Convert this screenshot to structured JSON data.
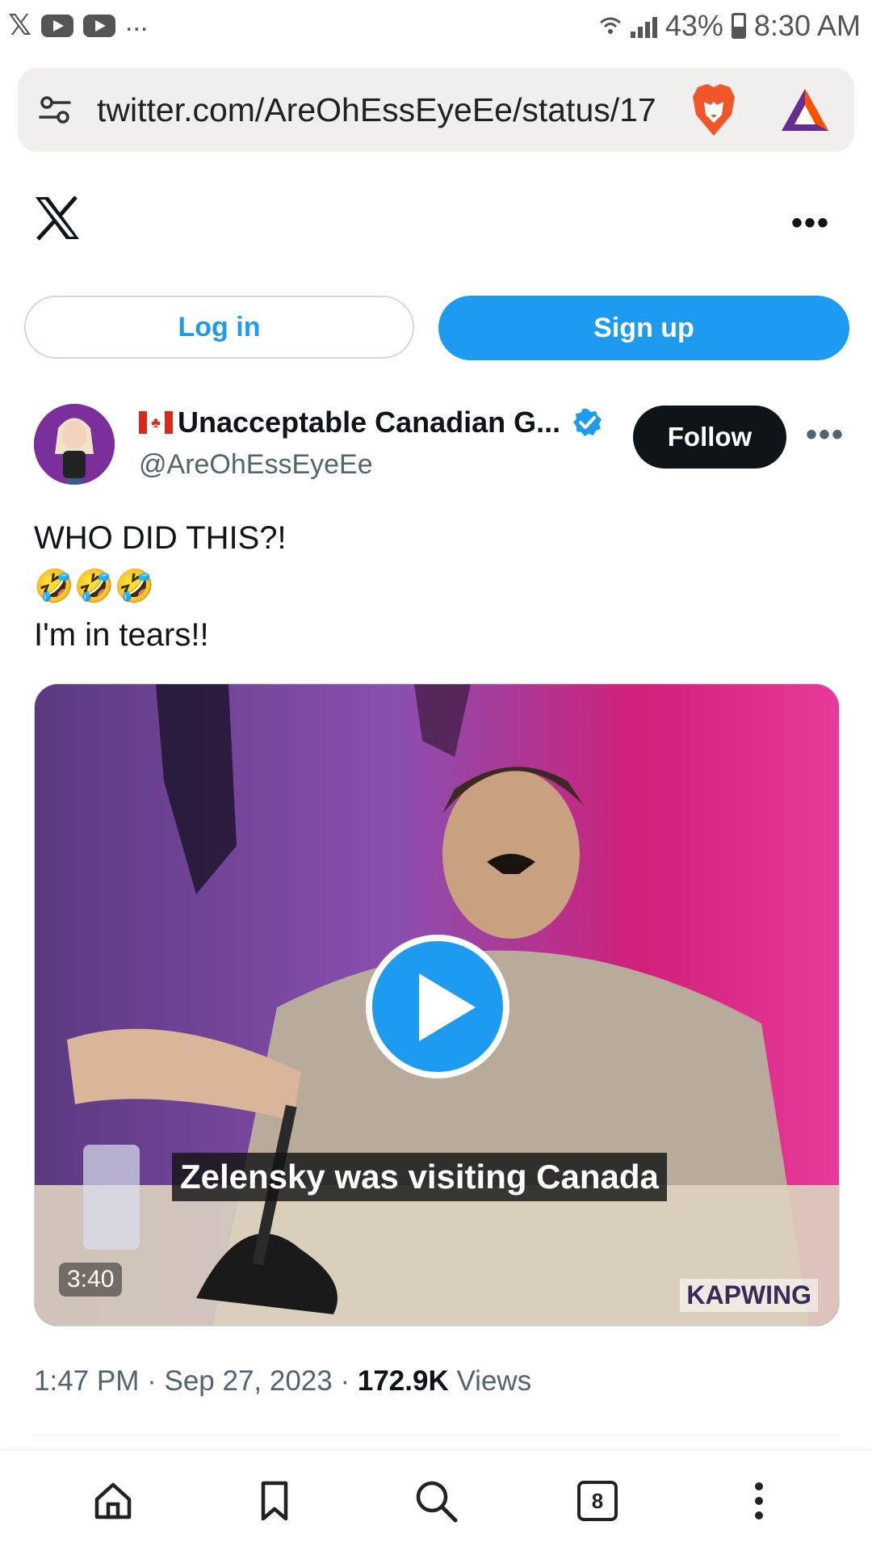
{
  "status_bar": {
    "left_icons": [
      "x-icon",
      "youtube-icon",
      "youtube-icon"
    ],
    "more": "...",
    "battery": "43%",
    "time": "8:30 AM"
  },
  "browser": {
    "url": "twitter.com/AreOhEssEyeEe/status/17",
    "icons": [
      "tune-icon",
      "brave-lion-icon",
      "bat-rewards-icon"
    ]
  },
  "header": {
    "logo": "X",
    "more": "•••"
  },
  "auth": {
    "login_label": "Log in",
    "signup_label": "Sign up"
  },
  "tweet": {
    "author_name": "Unacceptable Canadian G...",
    "author_handle": "@AreOhEssEyeEe",
    "follow_label": "Follow",
    "more": "•••",
    "text_lines": [
      "WHO DID THIS?!",
      "🤣🤣🤣",
      "I'm in tears!!"
    ],
    "media": {
      "caption": "Zelensky was visiting Canada",
      "duration": "3:40",
      "watermark": "KAPWING"
    },
    "time": "1:47 PM",
    "separator": "·",
    "date": "Sep 27, 2023",
    "views_count": "172.9K",
    "views_label": "Views"
  },
  "bottom_nav": {
    "items": [
      "home-icon",
      "bookmark-icon",
      "search-icon",
      "tabs-icon",
      "menu-icon"
    ],
    "tab_count": "8"
  },
  "colors": {
    "accent": "#1d9bf0",
    "follow_bg": "#0f1419",
    "secondary_text": "#536471"
  }
}
